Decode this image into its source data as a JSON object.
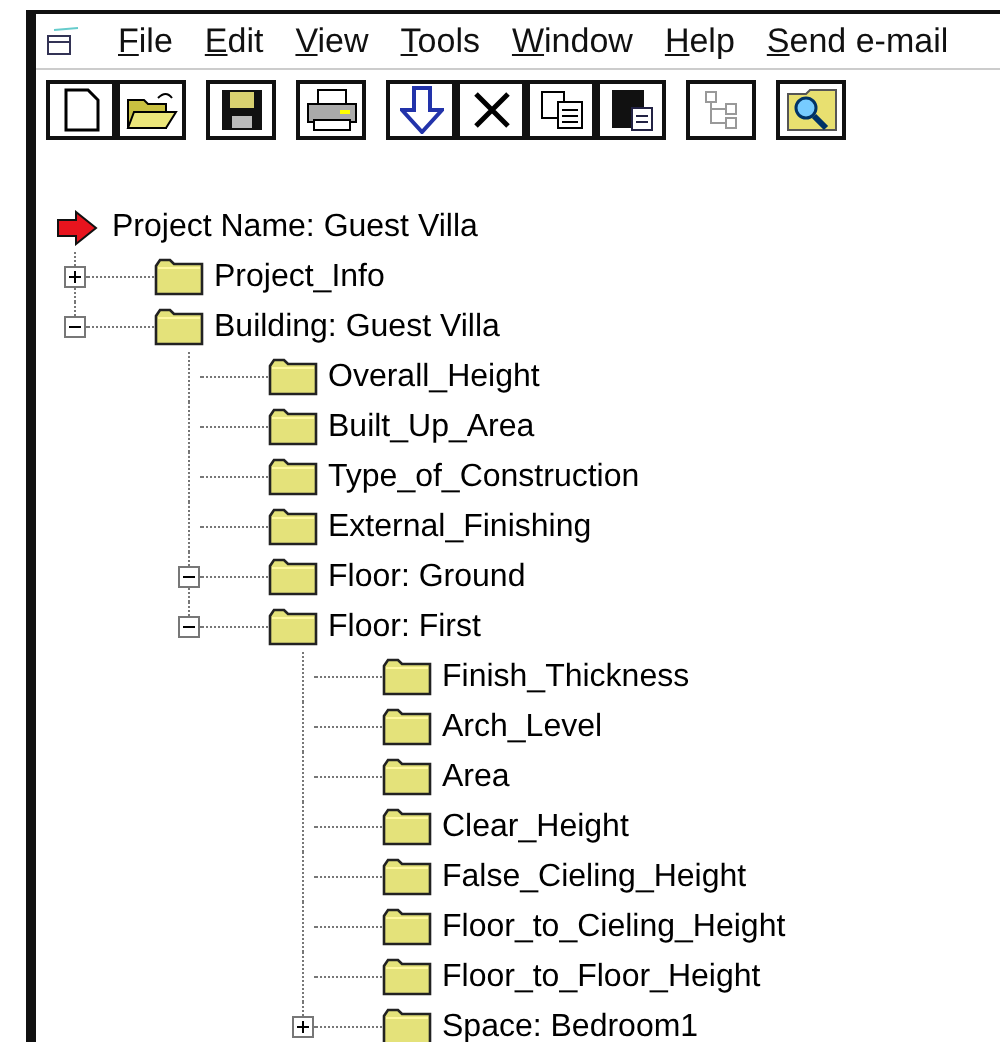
{
  "menu": [
    {
      "mnemonic": "F",
      "rest": "ile"
    },
    {
      "mnemonic": "E",
      "rest": "dit"
    },
    {
      "mnemonic": "V",
      "rest": "iew"
    },
    {
      "mnemonic": "T",
      "rest": "ools"
    },
    {
      "mnemonic": "W",
      "rest": "indow"
    },
    {
      "mnemonic": "H",
      "rest": "elp"
    },
    {
      "mnemonic": "S",
      "rest": "end e-mail"
    }
  ],
  "tree": {
    "label": "Project Name: Guest Villa",
    "children": [
      {
        "label": "Project_Info",
        "expanded": false
      },
      {
        "label": "Building: Guest Villa",
        "expanded": true,
        "children": [
          {
            "label": "Overall_Height"
          },
          {
            "label": "Built_Up_Area"
          },
          {
            "label": "Type_of_Construction"
          },
          {
            "label": "External_Finishing"
          },
          {
            "label": "Floor: Ground",
            "expanded": true
          },
          {
            "label": "Floor: First",
            "expanded": true,
            "children": [
              {
                "label": "Finish_Thickness"
              },
              {
                "label": "Arch_Level"
              },
              {
                "label": "Area"
              },
              {
                "label": "Clear_Height"
              },
              {
                "label": "False_Cieling_Height"
              },
              {
                "label": "Floor_to_Cieling_Height"
              },
              {
                "label": "Floor_to_Floor_Height"
              },
              {
                "label": "Space: Bedroom1",
                "expanded": false
              }
            ]
          }
        ]
      }
    ]
  }
}
